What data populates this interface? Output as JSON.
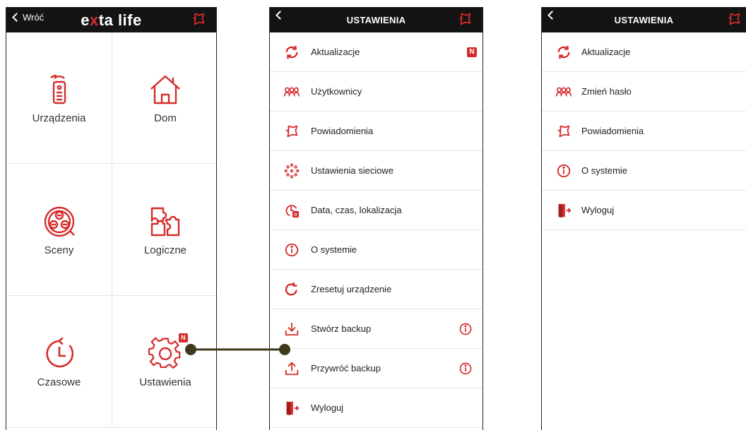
{
  "screen1": {
    "back_label": "Wróć",
    "logo_pre": "e",
    "logo_x": "x",
    "logo_post": "ta life",
    "tiles": [
      {
        "label": "Urządzenia",
        "icon": "remote-icon"
      },
      {
        "label": "Dom",
        "icon": "house-icon"
      },
      {
        "label": "Sceny",
        "icon": "scenes-icon"
      },
      {
        "label": "Logiczne",
        "icon": "puzzle-icon"
      },
      {
        "label": "Czasowe",
        "icon": "timer-icon"
      },
      {
        "label": "Ustawienia",
        "icon": "gear-icon",
        "badge": "N"
      }
    ]
  },
  "screen2": {
    "title": "USTAWIENIA",
    "items": [
      {
        "label": "Aktualizacje",
        "icon": "refresh-icon",
        "badge": "N"
      },
      {
        "label": "Użytkownicy",
        "icon": "users-icon"
      },
      {
        "label": "Powiadomienia",
        "icon": "bell-icon"
      },
      {
        "label": "Ustawienia sieciowe",
        "icon": "network-icon"
      },
      {
        "label": "Data, czas, lokalizacja",
        "icon": "clock-calendar-icon"
      },
      {
        "label": "O systemie",
        "icon": "info-icon"
      },
      {
        "label": "Zresetuj urządzenie",
        "icon": "reset-icon"
      },
      {
        "label": "Stwórz backup",
        "icon": "download-icon",
        "info": true
      },
      {
        "label": "Przywróć backup",
        "icon": "upload-icon",
        "info": true
      },
      {
        "label": "Wyloguj",
        "icon": "logout-icon"
      }
    ]
  },
  "screen3": {
    "title": "USTAWIENIA",
    "items": [
      {
        "label": "Aktualizacje",
        "icon": "refresh-icon"
      },
      {
        "label": "Zmień hasło",
        "icon": "users-icon"
      },
      {
        "label": "Powiadomienia",
        "icon": "bell-icon"
      },
      {
        "label": "O systemie",
        "icon": "info-icon"
      },
      {
        "label": "Wyloguj",
        "icon": "logout-icon"
      }
    ]
  },
  "colors": {
    "accent": "#d62b2b",
    "bar": "#141414",
    "connector": "#3f3a1e"
  }
}
